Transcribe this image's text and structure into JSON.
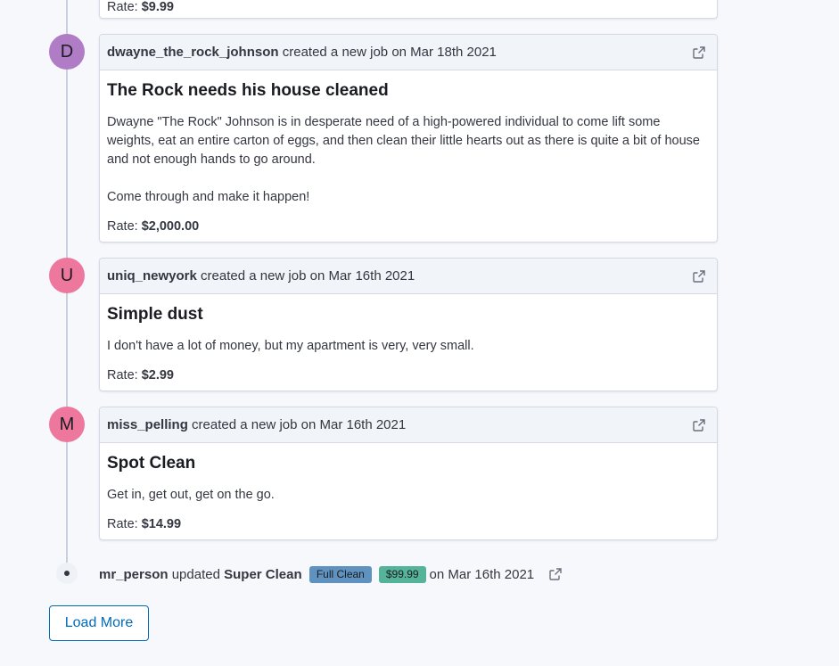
{
  "top_card": {
    "rate_label": "Rate:",
    "rate_value": "$9.99"
  },
  "feed": [
    {
      "avatar_letter": "D",
      "avatar_color": "#b07cc6",
      "user": "dwayne_the_rock_johnson",
      "action": "created a new job on Mar 18th 2021",
      "title": "The Rock needs his house cleaned",
      "description": "Dwayne \"The Rock\" Johnson is in desperate need of a high-powered individual to come lift some weights, eat an entire carton of eggs, and then clean their little hearts out as there is quite a bit of house and not enough hands to go around.\n\nCome through and make it happen!",
      "rate_label": "Rate:",
      "rate_value": "$2,000.00"
    },
    {
      "avatar_letter": "U",
      "avatar_color": "#ee789d",
      "user": "uniq_newyork",
      "action": "created a new job on Mar 16th 2021",
      "title": "Simple dust",
      "description": "I don't have a lot of money, but my apartment is very, very small.",
      "rate_label": "Rate:",
      "rate_value": "$2.99"
    },
    {
      "avatar_letter": "M",
      "avatar_color": "#ee789d",
      "user": "miss_pelling",
      "action": "created a new job on Mar 16th 2021",
      "title": "Spot Clean",
      "description": "Get in, get out, get on the go.",
      "rate_label": "Rate:",
      "rate_value": "$14.99"
    }
  ],
  "update": {
    "user": "mr_person",
    "verb": "updated",
    "target": "Super Clean",
    "badge_type": "Full Clean",
    "badge_type_color": "#6092c0",
    "badge_price": "$99.99",
    "badge_price_color": "#54b399",
    "date_text": "on Mar 16th 2021"
  },
  "load_more_label": "Load More"
}
